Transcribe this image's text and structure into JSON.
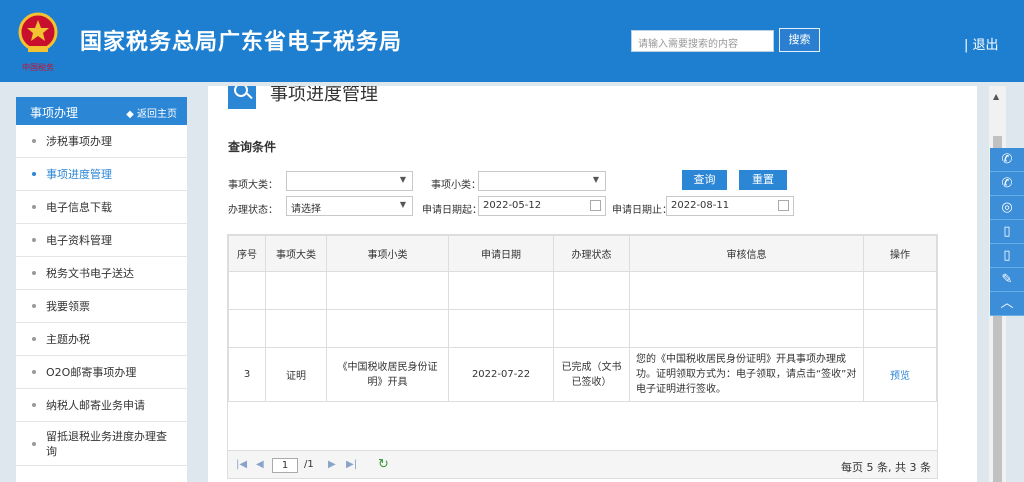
{
  "header": {
    "title": "国家税务总局广东省电子税务局",
    "emblem_caption": "中国税务",
    "search_placeholder": "请输入需要搜索的内容",
    "search_button": "搜索",
    "logout": "| 退出"
  },
  "sidebar": {
    "title": "事项办理",
    "back_label": "◆ 返回主页",
    "items": [
      {
        "label": "涉税事项办理"
      },
      {
        "label": "事项进度管理",
        "active": true
      },
      {
        "label": "电子信息下载"
      },
      {
        "label": "电子资料管理"
      },
      {
        "label": "税务文书电子送达"
      },
      {
        "label": "我要领票"
      },
      {
        "label": "主题办税"
      },
      {
        "label": "O2O邮寄事项办理"
      },
      {
        "label": "纳税人邮寄业务申请"
      },
      {
        "label": "留抵退税业务进度办理查询"
      }
    ]
  },
  "main": {
    "page_title": "事项进度管理",
    "query_title": "查询条件",
    "filters": {
      "major_label": "事项大类：",
      "major_value": "",
      "minor_label": "事项小类：",
      "minor_value": "",
      "status_label": "办理状态：",
      "status_value": "请选择",
      "date_from_label": "申请日期起：",
      "date_from_value": "2022-05-12",
      "date_to_label": "申请日期止：",
      "date_to_value": "2022-08-11",
      "query_button": "查询",
      "reset_button": "重置"
    },
    "table": {
      "columns": [
        "序号",
        "事项大类",
        "事项小类",
        "申请日期",
        "办理状态",
        "审核信息",
        "操作"
      ],
      "rows": [
        {
          "seq": "3",
          "major": "证明",
          "minor": "《中国税收居民身份证明》开具",
          "date": "2022-07-22",
          "status": "已完成（文书已签收）",
          "message": "您的《中国税收居民身份证明》开具事项办理成功。证明领取方式为：电子领取，请点击“签收”对电子证明进行签收。",
          "action": "预览"
        }
      ]
    },
    "pager": {
      "first": "|◀",
      "prev": "◀",
      "page": "1",
      "total": "/1",
      "next": "▶",
      "last": "▶|",
      "refresh": "↻",
      "summary": "每页 5 条, 共 3 条"
    }
  },
  "floatbar": {
    "icons": [
      "wechat-icon",
      "wechat-icon",
      "weibo-icon",
      "mobile-icon",
      "mobile-icon",
      "edit-icon",
      "back-to-top-icon"
    ],
    "glyphs": [
      "✆",
      "✆",
      "◎",
      "▯",
      "▯",
      "✎",
      "︿"
    ]
  },
  "colors": {
    "header_bg": "#1e7fd0",
    "accent": "#2b86d6",
    "page_bg": "#dfe7ee"
  }
}
